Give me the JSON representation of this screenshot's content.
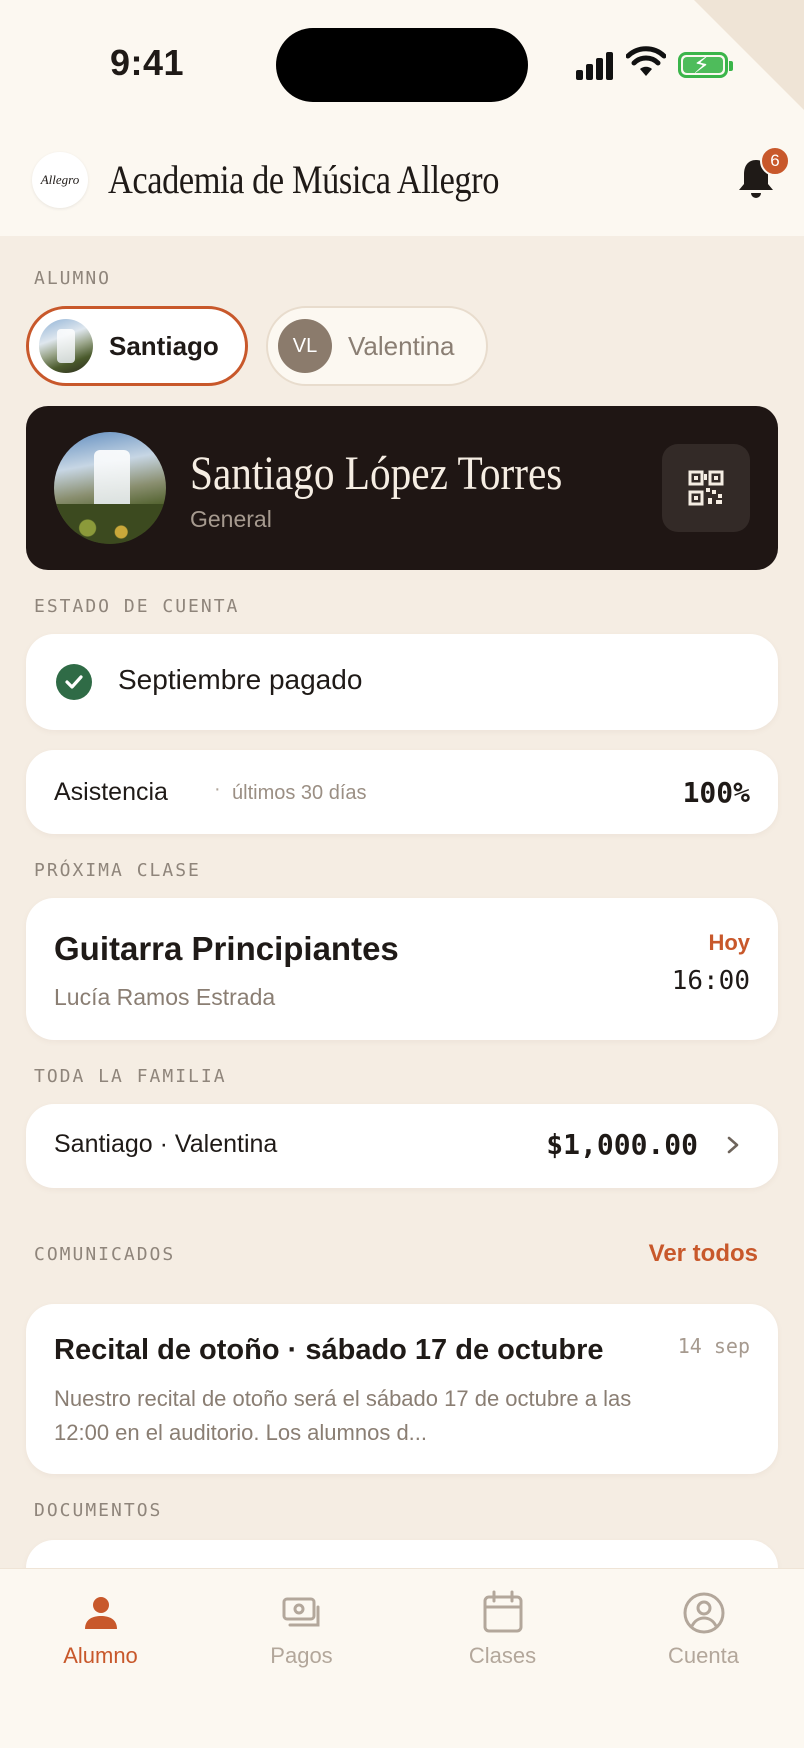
{
  "status_bar": {
    "time": "9:41"
  },
  "header": {
    "logo_text": "Allegro",
    "title": "Academia de Música Allegro",
    "notification_count": "6"
  },
  "students_section": {
    "label": "ALUMNO",
    "chips": [
      {
        "name": "Santiago",
        "selected": true
      },
      {
        "name": "Valentina",
        "initials": "VL",
        "selected": false
      }
    ]
  },
  "student_card": {
    "name": "Santiago López Torres",
    "level": "General"
  },
  "account_section": {
    "label": "ESTADO DE CUENTA",
    "status_text": "Septiembre pagado",
    "attendance_label": "Asistencia",
    "attendance_separator": "·",
    "attendance_period": "últimos 30 días",
    "attendance_value": "100%"
  },
  "next_class_section": {
    "label": "PRÓXIMA CLASE",
    "class_name": "Guitarra Principiantes",
    "teacher": "Lucía Ramos Estrada",
    "day": "Hoy",
    "time": "16:00"
  },
  "family_section": {
    "label": "TODA LA FAMILIA",
    "names": "Santiago · Valentina",
    "amount": "$1,000.00"
  },
  "announcements_section": {
    "label": "COMUNICADOS",
    "see_all": "Ver todos",
    "items": [
      {
        "title": "Recital de otoño · sábado 17 de octubre",
        "date": "14 sep",
        "body": "Nuestro recital de otoño será el sábado 17 de octubre a las 12:00 en el auditorio. Los alumnos d..."
      }
    ]
  },
  "documents_section": {
    "label": "DOCUMENTOS"
  },
  "tabbar": {
    "tabs": [
      {
        "label": "Alumno",
        "icon": "person-icon",
        "active": true
      },
      {
        "label": "Pagos",
        "icon": "cash-icon",
        "active": false
      },
      {
        "label": "Clases",
        "icon": "calendar-icon",
        "active": false
      },
      {
        "label": "Cuenta",
        "icon": "account-circle-icon",
        "active": false
      }
    ]
  },
  "colors": {
    "accent": "#c8582b",
    "background": "#f5ede3",
    "header_bg": "#fcf8f1",
    "card_dark": "#1f1614",
    "success": "#2f6b46"
  }
}
